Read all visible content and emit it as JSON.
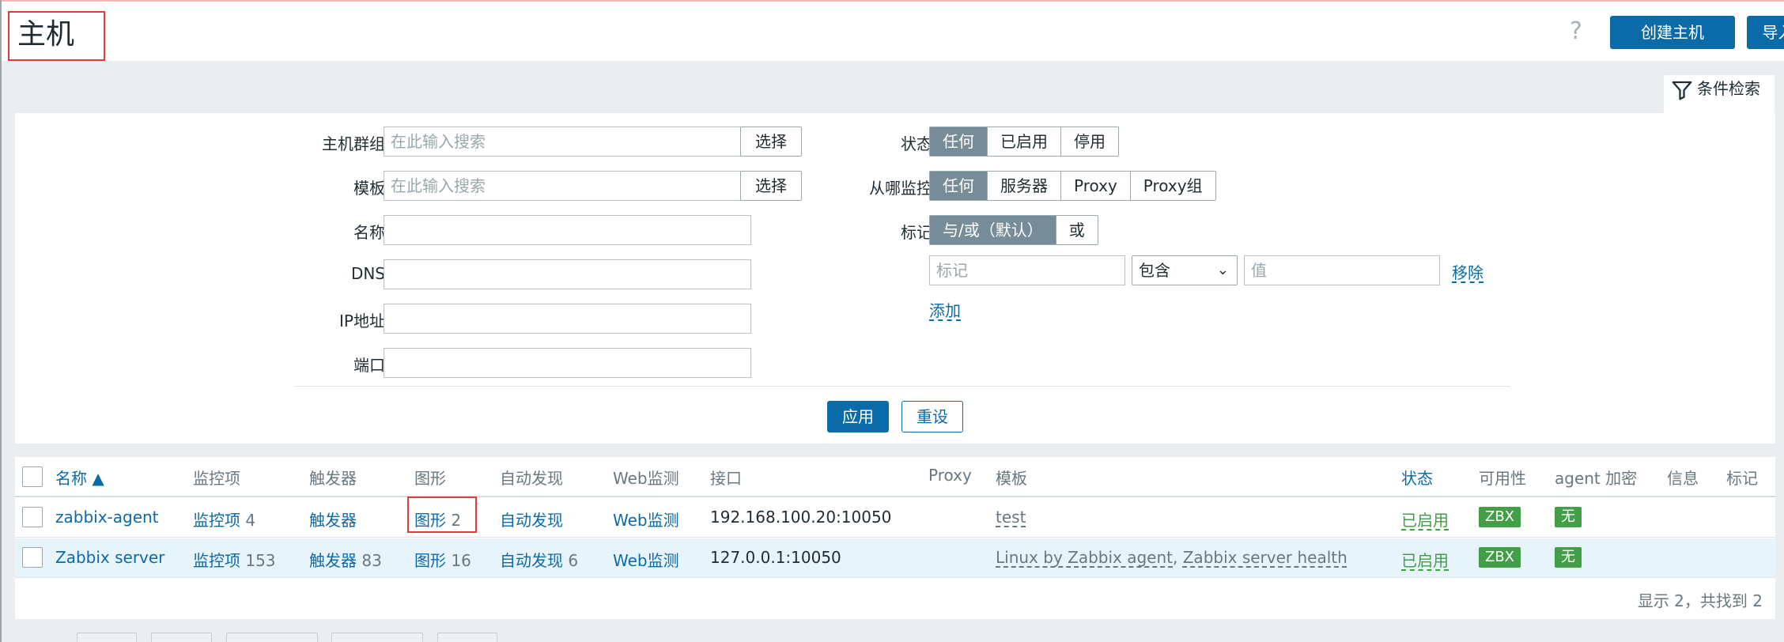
{
  "header": {
    "title": "主机",
    "help_icon": "help-icon",
    "create_host_label": "创建主机",
    "import_label": "导入"
  },
  "filter": {
    "tab_label": "条件检索",
    "host_groups": {
      "label": "主机群组",
      "placeholder": "在此输入搜索",
      "select_label": "选择"
    },
    "templates": {
      "label": "模板",
      "placeholder": "在此输入搜索",
      "select_label": "选择"
    },
    "name": {
      "label": "名称",
      "value": ""
    },
    "dns": {
      "label": "DNS",
      "value": ""
    },
    "ip": {
      "label": "IP地址",
      "value": ""
    },
    "port": {
      "label": "端口",
      "value": ""
    },
    "status": {
      "label": "状态",
      "options": [
        "任何",
        "已启用",
        "停用"
      ],
      "selected": "任何"
    },
    "monitored_by": {
      "label": "从哪监控",
      "options": [
        "任何",
        "服务器",
        "Proxy",
        "Proxy组"
      ],
      "selected": "任何"
    },
    "tags": {
      "label": "标记",
      "options": [
        "与/或（默认）",
        "或"
      ],
      "selected": "与/或（默认）",
      "tag_placeholder": "标记",
      "operator": "包含",
      "value_placeholder": "值",
      "remove_label": "移除",
      "add_label": "添加"
    },
    "apply_label": "应用",
    "reset_label": "重设"
  },
  "table": {
    "columns": [
      "名称 ▲",
      "监控项",
      "触发器",
      "图形",
      "自动发现",
      "Web监测",
      "接口",
      "Proxy",
      "模板",
      "状态",
      "可用性",
      "agent 加密",
      "信息",
      "标记"
    ],
    "rows": [
      {
        "name": "zabbix-agent",
        "items_label": "监控项",
        "items_count": "4",
        "triggers_label": "触发器",
        "triggers_count": "",
        "graphs_label": "图形",
        "graphs_count": "2",
        "discovery_label": "自动发现",
        "discovery_count": "",
        "web_label": "Web监测",
        "interface": "192.168.100.20:10050",
        "proxy": "",
        "templates": [
          "test"
        ],
        "status": "已启用",
        "availability": "ZBX",
        "encryption": "无"
      },
      {
        "name": "Zabbix server",
        "items_label": "监控项",
        "items_count": "153",
        "triggers_label": "触发器",
        "triggers_count": "83",
        "graphs_label": "图形",
        "graphs_count": "16",
        "discovery_label": "自动发现",
        "discovery_count": "6",
        "web_label": "Web监测",
        "interface": "127.0.0.1:10050",
        "proxy": "",
        "templates": [
          "Linux by Zabbix agent",
          "Zabbix server health"
        ],
        "status": "已启用",
        "availability": "ZBX",
        "encryption": "无"
      }
    ],
    "footer": "显示 2，共找到 2"
  },
  "colors": {
    "accent": "#0b6aa8",
    "enabled": "#429e47",
    "segment_selected": "#768d99"
  }
}
